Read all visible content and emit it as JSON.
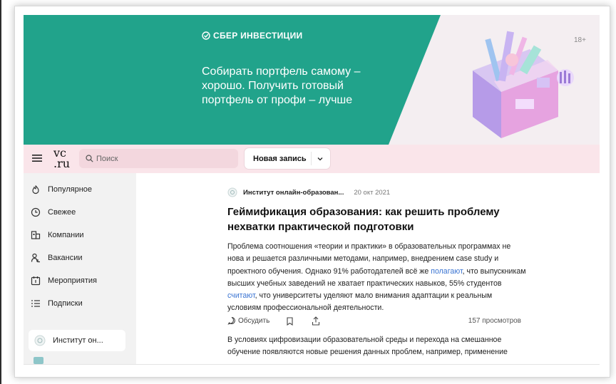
{
  "banner": {
    "brand": "СБЕР ИНВЕСТИЦИИ",
    "headline": "Собирать портфель самому – хорошо. Получить готовый портфель от профи – лучше",
    "age_rating": "18+",
    "colors": {
      "teal": "#21a38b",
      "pink": "#f4eef1"
    }
  },
  "header": {
    "logo": "vc.ru",
    "logo_top": "vc",
    "logo_bottom": ".ru",
    "search_placeholder": "Поиск",
    "new_post_label": "Новая запись"
  },
  "sidebar": {
    "items": [
      {
        "label": "Популярное",
        "icon": "fire-icon"
      },
      {
        "label": "Свежее",
        "icon": "clock-icon"
      },
      {
        "label": "Компании",
        "icon": "company-icon"
      },
      {
        "label": "Вакансии",
        "icon": "person-icon"
      },
      {
        "label": "Мероприятия",
        "icon": "calendar-icon"
      },
      {
        "label": "Подписки",
        "icon": "list-icon"
      }
    ],
    "subscription": "Институт он..."
  },
  "article": {
    "author": "Институт онлайн-образован...",
    "date": "20 окт 2021",
    "title": "Геймификация образования: как решить проблему нехватки практической подготовки",
    "lead_part1": "Проблема соотношения «теории и практики» в образовательных программах не нова и решается различными методами, например, внедрением case study и проектного обучения. Однако 91% работодателей всё же ",
    "lead_link1": "полагают",
    "lead_part2": ", что выпускникам высших учебных заведений не хватает практических навыков, 55% студентов ",
    "lead_link2": "считают",
    "lead_part3": ", что университеты уделяют мало внимания адаптации к реальным условиям профессиональной деятельности.",
    "discuss_label": "Обсудить",
    "views": "157 просмотров",
    "body_start": "В условиях цифровизации образовательной среды и перехода на смешанное обучение появляются новые решения данных проблем, например, применение",
    "link_color": "#3a74d2"
  }
}
